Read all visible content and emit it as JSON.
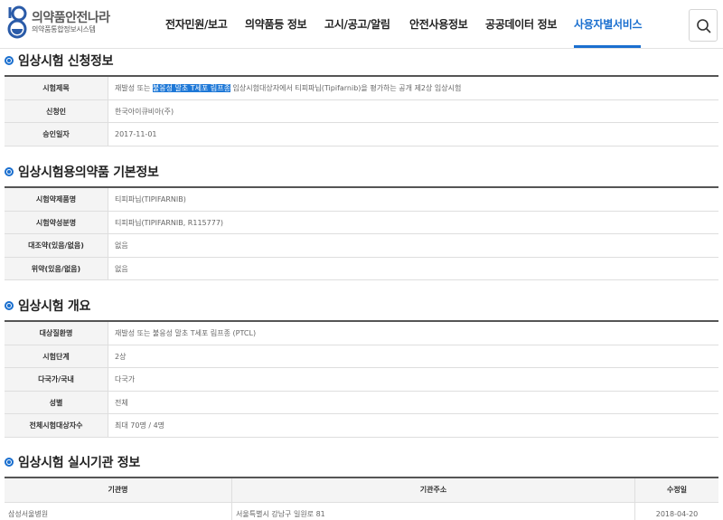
{
  "logo": {
    "title": "의약품안전나라",
    "subtitle": "의약품통합정보시스템"
  },
  "nav": {
    "items": [
      "전자민원/보고",
      "의약품등 정보",
      "고시/공고/알림",
      "안전사용정보",
      "공공데이터 정보",
      "사용자별서비스"
    ],
    "active_index": 5
  },
  "icons": {
    "search": "search-icon",
    "section_bullet": "circle-bullet-icon"
  },
  "colors": {
    "accent": "#1a6fcf",
    "highlight": "#1e78d7"
  },
  "sections": {
    "application": {
      "title": "임상시험 신청정보",
      "rows": [
        {
          "label": "시험제목",
          "value_before": "재발성 또는 ",
          "value_highlight": "불응성 말초 T세포 림프종",
          "value_after": " 임상시험대상자에서 티피파닙(Tipifarnib)을 평가하는 공개 제2상 임상시험"
        },
        {
          "label": "신청인",
          "value": "한국아이큐비아(주)"
        },
        {
          "label": "승인일자",
          "value": "2017-11-01"
        }
      ]
    },
    "drug": {
      "title": "임상시험용의약품 기본정보",
      "rows": [
        {
          "label": "시험약제품명",
          "value": "티피파닙(TIPIFARNIB)"
        },
        {
          "label": "시험약성분명",
          "value": "티피파닙(TIPIFARNIB, R115777)"
        },
        {
          "label": "대조약(있음/없음)",
          "value": "없음"
        },
        {
          "label": "위약(있음/없음)",
          "value": "없음"
        }
      ]
    },
    "overview": {
      "title": "임상시험 개요",
      "rows": [
        {
          "label": "대상질환명",
          "value": "재발성 또는 불응성 말초 T세포 림프종 (PTCL)"
        },
        {
          "label": "시험단계",
          "value": "2상"
        },
        {
          "label": "다국가/국내",
          "value": "다국가"
        },
        {
          "label": "성별",
          "value": "전체"
        },
        {
          "label": "전체시험대상자수",
          "value": "최대 70명 / 4명"
        }
      ]
    },
    "sites": {
      "title": "임상시험 실시기관 정보",
      "headers": [
        "기관명",
        "기관주소",
        "수정일"
      ],
      "rows": [
        {
          "name": "삼성서울병원",
          "address": "서울특별시 강남구 일원로 81",
          "updated": "2018-04-20"
        }
      ]
    }
  }
}
